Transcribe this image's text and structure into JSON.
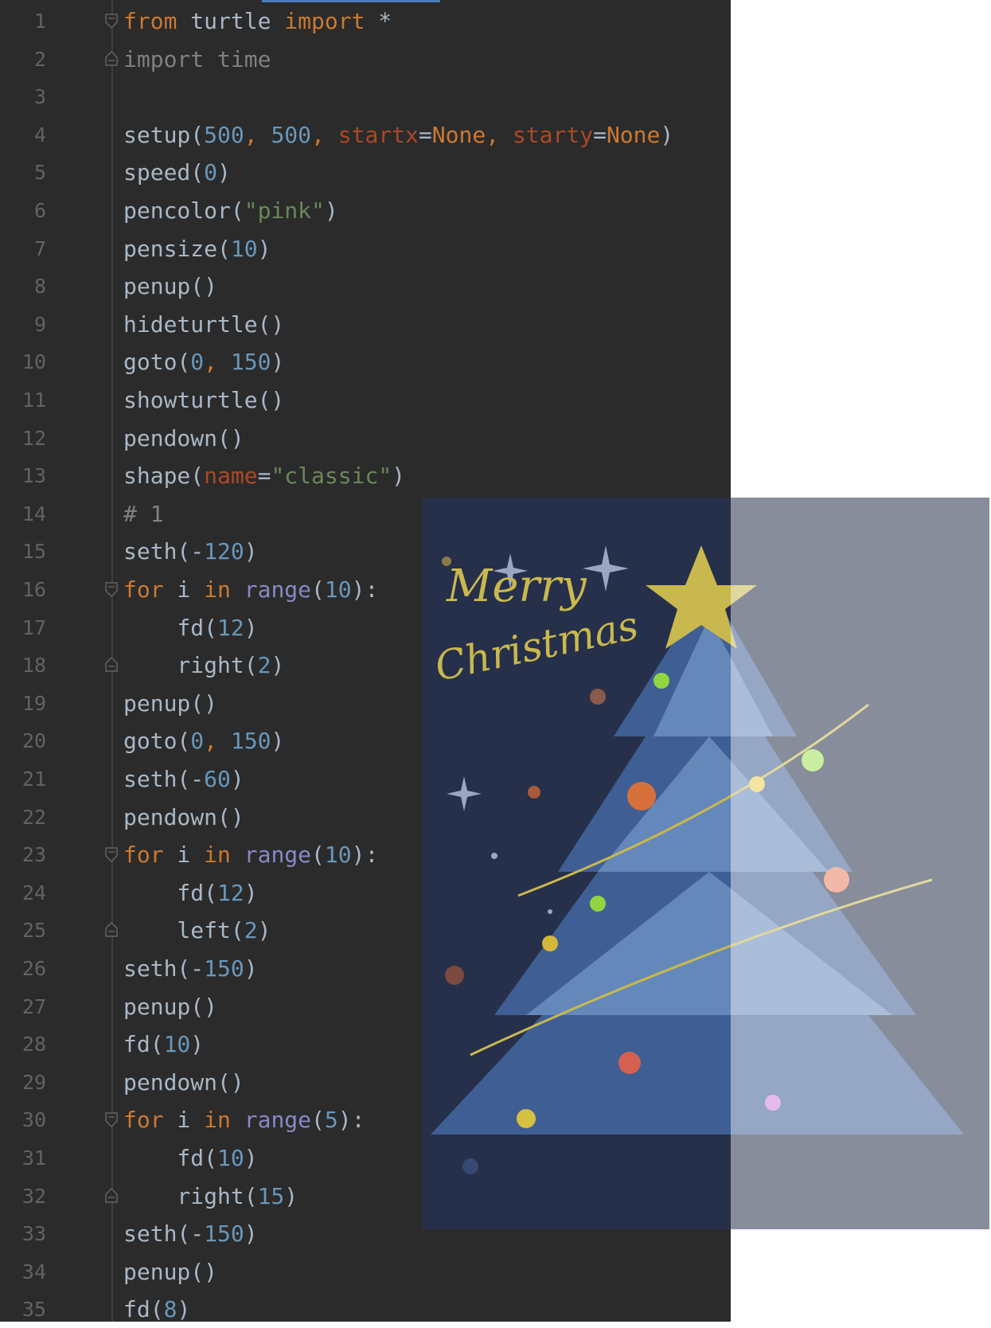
{
  "editor": {
    "colors": {
      "background": "#2b2b2b",
      "keyword": "#cc7832",
      "default": "#a9b7c6",
      "number": "#6897bb",
      "string": "#6a8759",
      "kwarg": "#aa4926",
      "builtin": "#8888c6",
      "comment": "#808080",
      "line_number": "#606366"
    },
    "lines": [
      {
        "n": "1",
        "fold": "start",
        "tokens": [
          [
            "kw",
            "from"
          ],
          [
            "op",
            " turtle "
          ],
          [
            "kw",
            "import"
          ],
          [
            "op",
            " *"
          ]
        ]
      },
      {
        "n": "2",
        "fold": "end",
        "tokens": [
          [
            "unused",
            "import time"
          ]
        ]
      },
      {
        "n": "3",
        "tokens": []
      },
      {
        "n": "4",
        "tokens": [
          [
            "op",
            "setup("
          ],
          [
            "num",
            "500"
          ],
          [
            "kw",
            ", "
          ],
          [
            "num",
            "500"
          ],
          [
            "kw",
            ", "
          ],
          [
            "kwarg",
            "startx"
          ],
          [
            "op",
            "="
          ],
          [
            "none",
            "None"
          ],
          [
            "kw",
            ", "
          ],
          [
            "kwarg",
            "starty"
          ],
          [
            "op",
            "="
          ],
          [
            "none",
            "None"
          ],
          [
            "op",
            ")"
          ]
        ]
      },
      {
        "n": "5",
        "tokens": [
          [
            "op",
            "speed("
          ],
          [
            "num",
            "0"
          ],
          [
            "op",
            ")"
          ]
        ]
      },
      {
        "n": "6",
        "tokens": [
          [
            "op",
            "pencolor("
          ],
          [
            "str",
            "\"pink\""
          ],
          [
            "op",
            ")"
          ]
        ]
      },
      {
        "n": "7",
        "tokens": [
          [
            "op",
            "pensize("
          ],
          [
            "num",
            "10"
          ],
          [
            "op",
            ")"
          ]
        ]
      },
      {
        "n": "8",
        "tokens": [
          [
            "op",
            "penup()"
          ]
        ]
      },
      {
        "n": "9",
        "tokens": [
          [
            "op",
            "hideturtle()"
          ]
        ]
      },
      {
        "n": "10",
        "tokens": [
          [
            "op",
            "goto("
          ],
          [
            "num",
            "0"
          ],
          [
            "kw",
            ", "
          ],
          [
            "num",
            "150"
          ],
          [
            "op",
            ")"
          ]
        ]
      },
      {
        "n": "11",
        "tokens": [
          [
            "op",
            "showturtle()"
          ]
        ]
      },
      {
        "n": "12",
        "tokens": [
          [
            "op",
            "pendown()"
          ]
        ]
      },
      {
        "n": "13",
        "tokens": [
          [
            "op",
            "shape("
          ],
          [
            "kwarg",
            "name"
          ],
          [
            "op",
            "="
          ],
          [
            "str",
            "\"classic\""
          ],
          [
            "op",
            ")"
          ]
        ]
      },
      {
        "n": "14",
        "tokens": [
          [
            "cm",
            "# 1"
          ]
        ]
      },
      {
        "n": "15",
        "tokens": [
          [
            "op",
            "seth(-"
          ],
          [
            "num",
            "120"
          ],
          [
            "op",
            ")"
          ]
        ]
      },
      {
        "n": "16",
        "fold": "start",
        "tokens": [
          [
            "kw",
            "for"
          ],
          [
            "op",
            " i "
          ],
          [
            "kw",
            "in"
          ],
          [
            "op",
            " "
          ],
          [
            "bi",
            "range"
          ],
          [
            "op",
            "("
          ],
          [
            "num",
            "10"
          ],
          [
            "op",
            "):"
          ]
        ]
      },
      {
        "n": "17",
        "tokens": [
          [
            "op",
            "    fd("
          ],
          [
            "num",
            "12"
          ],
          [
            "op",
            ")"
          ]
        ]
      },
      {
        "n": "18",
        "fold": "end",
        "tokens": [
          [
            "op",
            "    right("
          ],
          [
            "num",
            "2"
          ],
          [
            "op",
            ")"
          ]
        ]
      },
      {
        "n": "19",
        "tokens": [
          [
            "op",
            "penup()"
          ]
        ]
      },
      {
        "n": "20",
        "tokens": [
          [
            "op",
            "goto("
          ],
          [
            "num",
            "0"
          ],
          [
            "kw",
            ", "
          ],
          [
            "num",
            "150"
          ],
          [
            "op",
            ")"
          ]
        ]
      },
      {
        "n": "21",
        "tokens": [
          [
            "op",
            "seth(-"
          ],
          [
            "num",
            "60"
          ],
          [
            "op",
            ")"
          ]
        ]
      },
      {
        "n": "22",
        "tokens": [
          [
            "op",
            "pendown()"
          ]
        ]
      },
      {
        "n": "23",
        "fold": "start",
        "tokens": [
          [
            "kw",
            "for"
          ],
          [
            "op",
            " i "
          ],
          [
            "kw",
            "in"
          ],
          [
            "op",
            " "
          ],
          [
            "bi",
            "range"
          ],
          [
            "op",
            "("
          ],
          [
            "num",
            "10"
          ],
          [
            "op",
            "):"
          ]
        ]
      },
      {
        "n": "24",
        "tokens": [
          [
            "op",
            "    fd("
          ],
          [
            "num",
            "12"
          ],
          [
            "op",
            ")"
          ]
        ]
      },
      {
        "n": "25",
        "fold": "end",
        "tokens": [
          [
            "op",
            "    left("
          ],
          [
            "num",
            "2"
          ],
          [
            "op",
            ")"
          ]
        ]
      },
      {
        "n": "26",
        "tokens": [
          [
            "op",
            "seth(-"
          ],
          [
            "num",
            "150"
          ],
          [
            "op",
            ")"
          ]
        ]
      },
      {
        "n": "27",
        "tokens": [
          [
            "op",
            "penup()"
          ]
        ]
      },
      {
        "n": "28",
        "tokens": [
          [
            "op",
            "fd("
          ],
          [
            "num",
            "10"
          ],
          [
            "op",
            ")"
          ]
        ]
      },
      {
        "n": "29",
        "tokens": [
          [
            "op",
            "pendown()"
          ]
        ]
      },
      {
        "n": "30",
        "fold": "start",
        "tokens": [
          [
            "kw",
            "for"
          ],
          [
            "op",
            " i "
          ],
          [
            "kw",
            "in"
          ],
          [
            "op",
            " "
          ],
          [
            "bi",
            "range"
          ],
          [
            "op",
            "("
          ],
          [
            "num",
            "5"
          ],
          [
            "op",
            "):"
          ]
        ]
      },
      {
        "n": "31",
        "tokens": [
          [
            "op",
            "    fd("
          ],
          [
            "num",
            "10"
          ],
          [
            "op",
            ")"
          ]
        ]
      },
      {
        "n": "32",
        "fold": "end",
        "tokens": [
          [
            "op",
            "    right("
          ],
          [
            "num",
            "15"
          ],
          [
            "op",
            ")"
          ]
        ]
      },
      {
        "n": "33",
        "tokens": [
          [
            "op",
            "seth(-"
          ],
          [
            "num",
            "150"
          ],
          [
            "op",
            ")"
          ]
        ]
      },
      {
        "n": "34",
        "tokens": [
          [
            "op",
            "penup()"
          ]
        ]
      },
      {
        "n": "35",
        "tokens": [
          [
            "op",
            "fd("
          ],
          [
            "num",
            "8"
          ],
          [
            "op",
            ")"
          ]
        ]
      }
    ]
  },
  "artwork": {
    "lettering": [
      "Merry",
      "Christmas"
    ],
    "colors": {
      "sky": "#26304a",
      "overlay": "#8a94ab",
      "star": "#c9b84e",
      "tree": "#4a6fa5"
    }
  }
}
